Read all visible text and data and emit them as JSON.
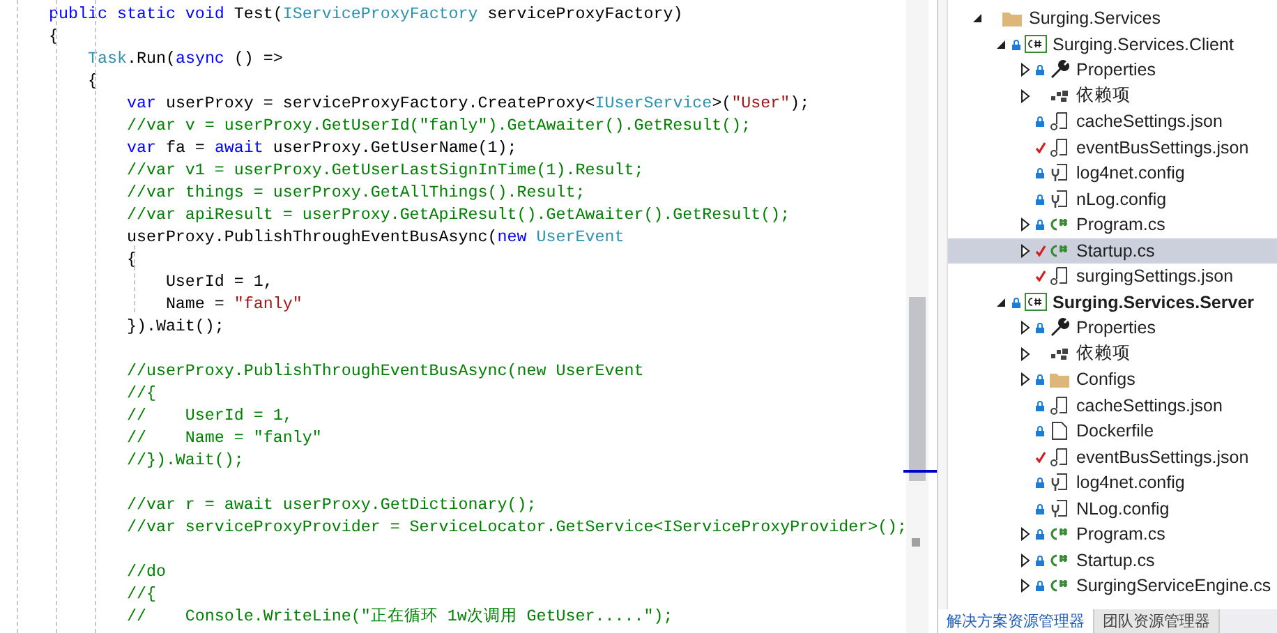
{
  "editor": {
    "lines": [
      {
        "kind": "code",
        "segments": [
          {
            "kind": "keyword",
            "text": "public static void "
          },
          {
            "kind": "plain",
            "text": "Test("
          },
          {
            "kind": "type",
            "text": "IServiceProxyFactory"
          },
          {
            "kind": "plain",
            "text": " serviceProxyFactory)"
          }
        ]
      },
      {
        "kind": "code",
        "segments": [
          {
            "kind": "plain",
            "text": "{"
          }
        ]
      },
      {
        "kind": "code",
        "segments": [
          {
            "kind": "type",
            "text": "    Task"
          },
          {
            "kind": "plain",
            "text": ".Run("
          },
          {
            "kind": "keyword",
            "text": "async"
          },
          {
            "kind": "plain",
            "text": " () =>"
          }
        ]
      },
      {
        "kind": "code",
        "segments": [
          {
            "kind": "plain",
            "text": "    {"
          }
        ]
      },
      {
        "kind": "code",
        "segments": [
          {
            "kind": "keyword",
            "text": "        var"
          },
          {
            "kind": "plain",
            "text": " userProxy = serviceProxyFactory.CreateProxy<"
          },
          {
            "kind": "type",
            "text": "IUserService"
          },
          {
            "kind": "plain",
            "text": ">("
          },
          {
            "kind": "string",
            "text": "\"User\""
          },
          {
            "kind": "plain",
            "text": ");"
          }
        ]
      },
      {
        "kind": "code",
        "segments": [
          {
            "kind": "comment",
            "text": "        //var v = userProxy.GetUserId(\"fanly\").GetAwaiter().GetResult();"
          }
        ]
      },
      {
        "kind": "code",
        "segments": [
          {
            "kind": "keyword",
            "text": "        var"
          },
          {
            "kind": "plain",
            "text": " fa = "
          },
          {
            "kind": "keyword",
            "text": "await"
          },
          {
            "kind": "plain",
            "text": " userProxy.GetUserName(1);"
          }
        ]
      },
      {
        "kind": "code",
        "segments": [
          {
            "kind": "comment",
            "text": "        //var v1 = userProxy.GetUserLastSignInTime(1).Result;"
          }
        ]
      },
      {
        "kind": "code",
        "segments": [
          {
            "kind": "comment",
            "text": "        //var things = userProxy.GetAllThings().Result;"
          }
        ]
      },
      {
        "kind": "code",
        "segments": [
          {
            "kind": "comment",
            "text": "        //var apiResult = userProxy.GetApiResult().GetAwaiter().GetResult();"
          }
        ]
      },
      {
        "kind": "code",
        "segments": [
          {
            "kind": "plain",
            "text": "        userProxy.PublishThroughEventBusAsync("
          },
          {
            "kind": "keyword",
            "text": "new"
          },
          {
            "kind": "type",
            "text": " UserEvent"
          }
        ]
      },
      {
        "kind": "code",
        "segments": [
          {
            "kind": "plain",
            "text": "        {"
          }
        ]
      },
      {
        "kind": "code",
        "segments": [
          {
            "kind": "plain",
            "text": "            UserId = 1,"
          }
        ]
      },
      {
        "kind": "code",
        "segments": [
          {
            "kind": "plain",
            "text": "            Name = "
          },
          {
            "kind": "string",
            "text": "\"fanly\""
          }
        ]
      },
      {
        "kind": "code",
        "segments": [
          {
            "kind": "plain",
            "text": "        }).Wait();"
          }
        ]
      },
      {
        "kind": "blank"
      },
      {
        "kind": "code",
        "segments": [
          {
            "kind": "comment",
            "text": "        //userProxy.PublishThroughEventBusAsync(new UserEvent"
          }
        ]
      },
      {
        "kind": "code",
        "segments": [
          {
            "kind": "comment",
            "text": "        //{"
          }
        ]
      },
      {
        "kind": "code",
        "segments": [
          {
            "kind": "comment",
            "text": "        //    UserId = 1,"
          }
        ]
      },
      {
        "kind": "code",
        "segments": [
          {
            "kind": "comment",
            "text": "        //    Name = \"fanly\""
          }
        ]
      },
      {
        "kind": "code",
        "segments": [
          {
            "kind": "comment",
            "text": "        //}).Wait();"
          }
        ]
      },
      {
        "kind": "blank"
      },
      {
        "kind": "code",
        "segments": [
          {
            "kind": "comment",
            "text": "        //var r = await userProxy.GetDictionary();"
          }
        ]
      },
      {
        "kind": "code",
        "segments": [
          {
            "kind": "comment",
            "text": "        //var serviceProxyProvider = ServiceLocator.GetService<IServiceProxyProvider>();"
          }
        ]
      },
      {
        "kind": "blank"
      },
      {
        "kind": "code",
        "segments": [
          {
            "kind": "comment",
            "text": "        //do"
          }
        ]
      },
      {
        "kind": "code",
        "segments": [
          {
            "kind": "comment",
            "text": "        //{"
          }
        ]
      },
      {
        "kind": "code",
        "segments": [
          {
            "kind": "comment",
            "text": "        //    Console.WriteLine(\"正在循环 1w次调用 GetUser.....\");"
          }
        ]
      }
    ]
  },
  "solution_explorer": {
    "items": [
      {
        "label": "Surging.Services",
        "kind": "folder",
        "locked": false,
        "pending_edit": false,
        "expanded": true,
        "selected": false,
        "bold": false,
        "children": [
          {
            "label": "Surging.Services.Client",
            "kind": "project",
            "locked": true,
            "pending_edit": false,
            "expanded": true,
            "selected": false,
            "bold": false,
            "children": [
              {
                "label": "Properties",
                "kind": "properties",
                "locked": true,
                "pending_edit": false,
                "expanded": false,
                "selected": false,
                "bold": false
              },
              {
                "label": "依赖项",
                "kind": "dependencies",
                "locked": false,
                "pending_edit": false,
                "expanded": false,
                "selected": false,
                "bold": false
              },
              {
                "label": "cacheSettings.json",
                "kind": "settings",
                "locked": true,
                "pending_edit": false,
                "selected": false,
                "bold": false
              },
              {
                "label": "eventBusSettings.json",
                "kind": "settings",
                "locked": false,
                "pending_edit": true,
                "selected": false,
                "bold": false
              },
              {
                "label": "log4net.config",
                "kind": "config",
                "locked": true,
                "pending_edit": false,
                "selected": false,
                "bold": false
              },
              {
                "label": "nLog.config",
                "kind": "config",
                "locked": true,
                "pending_edit": false,
                "selected": false,
                "bold": false
              },
              {
                "label": "Program.cs",
                "kind": "source",
                "locked": true,
                "pending_edit": false,
                "expanded": false,
                "selected": false,
                "bold": false
              },
              {
                "label": "Startup.cs",
                "kind": "source",
                "locked": false,
                "pending_edit": true,
                "expanded": false,
                "selected": true,
                "bold": false
              },
              {
                "label": "surgingSettings.json",
                "kind": "settings",
                "locked": false,
                "pending_edit": true,
                "selected": false,
                "bold": false
              }
            ]
          },
          {
            "label": "Surging.Services.Server",
            "kind": "project",
            "locked": true,
            "pending_edit": false,
            "expanded": true,
            "selected": false,
            "bold": true,
            "children": [
              {
                "label": "Properties",
                "kind": "properties",
                "locked": true,
                "pending_edit": false,
                "expanded": false,
                "selected": false,
                "bold": false
              },
              {
                "label": "依赖项",
                "kind": "dependencies",
                "locked": false,
                "pending_edit": false,
                "expanded": false,
                "selected": false,
                "bold": false
              },
              {
                "label": "Configs",
                "kind": "folder",
                "locked": true,
                "pending_edit": false,
                "expanded": false,
                "selected": false,
                "bold": false
              },
              {
                "label": "cacheSettings.json",
                "kind": "settings",
                "locked": true,
                "pending_edit": false,
                "selected": false,
                "bold": false
              },
              {
                "label": "Dockerfile",
                "kind": "file",
                "locked": true,
                "pending_edit": false,
                "selected": false,
                "bold": false
              },
              {
                "label": "eventBusSettings.json",
                "kind": "settings",
                "locked": false,
                "pending_edit": true,
                "selected": false,
                "bold": false
              },
              {
                "label": "log4net.config",
                "kind": "config",
                "locked": true,
                "pending_edit": false,
                "selected": false,
                "bold": false
              },
              {
                "label": "NLog.config",
                "kind": "config",
                "locked": true,
                "pending_edit": false,
                "selected": false,
                "bold": false
              },
              {
                "label": "Program.cs",
                "kind": "source",
                "locked": true,
                "pending_edit": false,
                "expanded": false,
                "selected": false,
                "bold": false
              },
              {
                "label": "Startup.cs",
                "kind": "source",
                "locked": true,
                "pending_edit": false,
                "expanded": false,
                "selected": false,
                "bold": false
              },
              {
                "label": "SurgingServiceEngine.cs",
                "kind": "source",
                "locked": true,
                "pending_edit": false,
                "expanded": false,
                "selected": false,
                "bold": false
              }
            ]
          }
        ]
      }
    ],
    "tabs": [
      {
        "label": "解决方案资源管理器",
        "selected": true
      },
      {
        "label": "团队资源管理器",
        "selected": false
      }
    ]
  }
}
